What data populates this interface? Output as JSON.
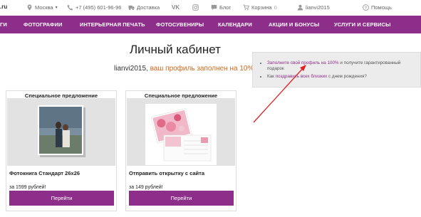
{
  "topbar": {
    "logo_fragment": ".ru",
    "city": "Москва",
    "phone": "+7 (495) 601-96-96",
    "delivery": "Доставка",
    "blog": "Блог",
    "cart": "Корзина",
    "cart_count": "0",
    "username": "lianvi2015",
    "help": "Помощь"
  },
  "nav": {
    "items": [
      "ГИ",
      "ФОТОГРАФИИ",
      "ИНТЕРЬЕРНАЯ ПЕЧАТЬ",
      "ФОТОСУВЕНИРЫ",
      "КАЛЕНДАРИ",
      "АКЦИИ И БОНУСЫ",
      "УСЛУГИ И СЕРВИСЫ"
    ]
  },
  "main": {
    "title": "Личный кабинет",
    "username": "lianvi2015,",
    "profile_status": "ваш профиль заполнен на 10%",
    "help_mark": "?"
  },
  "tips": {
    "item1_link": "Заполните свой профиль на 100%",
    "item1_rest": " и получите гарантированный подарок",
    "item2_prefix": "Как ",
    "item2_link": "поздравить всех близких",
    "item2_rest": " с днем рождения?"
  },
  "cards": [
    {
      "header": "Специальное предложение",
      "name": "Фотокнига Стандарт 26х26",
      "price": "за 1599 рублей!",
      "button": "Перейти"
    },
    {
      "header": "Специальное предложение",
      "name": "Отправить открытку с сайта",
      "price": "за 149 рублей!",
      "button": "Перейти"
    }
  ],
  "colors": {
    "brand": "#8e2e8b",
    "status": "#d2691e",
    "arrow": "#e02020"
  },
  "icons": [
    "location-icon",
    "phone-icon",
    "delivery-icon",
    "vk-icon",
    "instagram-icon",
    "blog-icon",
    "cart-icon",
    "user-icon",
    "help-icon"
  ]
}
